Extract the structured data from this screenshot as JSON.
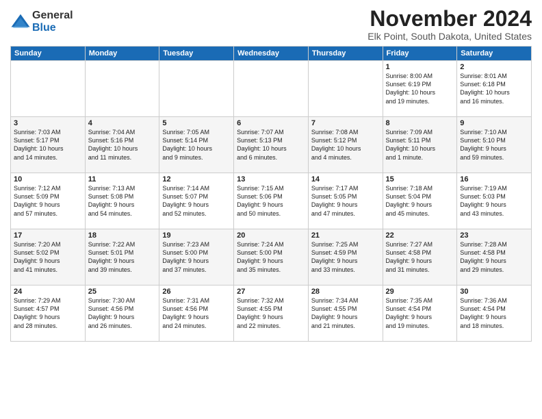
{
  "logo": {
    "general": "General",
    "blue": "Blue"
  },
  "title": "November 2024",
  "location": "Elk Point, South Dakota, United States",
  "days_of_week": [
    "Sunday",
    "Monday",
    "Tuesday",
    "Wednesday",
    "Thursday",
    "Friday",
    "Saturday"
  ],
  "weeks": [
    [
      {
        "day": "",
        "info": ""
      },
      {
        "day": "",
        "info": ""
      },
      {
        "day": "",
        "info": ""
      },
      {
        "day": "",
        "info": ""
      },
      {
        "day": "",
        "info": ""
      },
      {
        "day": "1",
        "info": "Sunrise: 8:00 AM\nSunset: 6:19 PM\nDaylight: 10 hours\nand 19 minutes."
      },
      {
        "day": "2",
        "info": "Sunrise: 8:01 AM\nSunset: 6:18 PM\nDaylight: 10 hours\nand 16 minutes."
      }
    ],
    [
      {
        "day": "3",
        "info": "Sunrise: 7:03 AM\nSunset: 5:17 PM\nDaylight: 10 hours\nand 14 minutes."
      },
      {
        "day": "4",
        "info": "Sunrise: 7:04 AM\nSunset: 5:16 PM\nDaylight: 10 hours\nand 11 minutes."
      },
      {
        "day": "5",
        "info": "Sunrise: 7:05 AM\nSunset: 5:14 PM\nDaylight: 10 hours\nand 9 minutes."
      },
      {
        "day": "6",
        "info": "Sunrise: 7:07 AM\nSunset: 5:13 PM\nDaylight: 10 hours\nand 6 minutes."
      },
      {
        "day": "7",
        "info": "Sunrise: 7:08 AM\nSunset: 5:12 PM\nDaylight: 10 hours\nand 4 minutes."
      },
      {
        "day": "8",
        "info": "Sunrise: 7:09 AM\nSunset: 5:11 PM\nDaylight: 10 hours\nand 1 minute."
      },
      {
        "day": "9",
        "info": "Sunrise: 7:10 AM\nSunset: 5:10 PM\nDaylight: 9 hours\nand 59 minutes."
      }
    ],
    [
      {
        "day": "10",
        "info": "Sunrise: 7:12 AM\nSunset: 5:09 PM\nDaylight: 9 hours\nand 57 minutes."
      },
      {
        "day": "11",
        "info": "Sunrise: 7:13 AM\nSunset: 5:08 PM\nDaylight: 9 hours\nand 54 minutes."
      },
      {
        "day": "12",
        "info": "Sunrise: 7:14 AM\nSunset: 5:07 PM\nDaylight: 9 hours\nand 52 minutes."
      },
      {
        "day": "13",
        "info": "Sunrise: 7:15 AM\nSunset: 5:06 PM\nDaylight: 9 hours\nand 50 minutes."
      },
      {
        "day": "14",
        "info": "Sunrise: 7:17 AM\nSunset: 5:05 PM\nDaylight: 9 hours\nand 47 minutes."
      },
      {
        "day": "15",
        "info": "Sunrise: 7:18 AM\nSunset: 5:04 PM\nDaylight: 9 hours\nand 45 minutes."
      },
      {
        "day": "16",
        "info": "Sunrise: 7:19 AM\nSunset: 5:03 PM\nDaylight: 9 hours\nand 43 minutes."
      }
    ],
    [
      {
        "day": "17",
        "info": "Sunrise: 7:20 AM\nSunset: 5:02 PM\nDaylight: 9 hours\nand 41 minutes."
      },
      {
        "day": "18",
        "info": "Sunrise: 7:22 AM\nSunset: 5:01 PM\nDaylight: 9 hours\nand 39 minutes."
      },
      {
        "day": "19",
        "info": "Sunrise: 7:23 AM\nSunset: 5:00 PM\nDaylight: 9 hours\nand 37 minutes."
      },
      {
        "day": "20",
        "info": "Sunrise: 7:24 AM\nSunset: 5:00 PM\nDaylight: 9 hours\nand 35 minutes."
      },
      {
        "day": "21",
        "info": "Sunrise: 7:25 AM\nSunset: 4:59 PM\nDaylight: 9 hours\nand 33 minutes."
      },
      {
        "day": "22",
        "info": "Sunrise: 7:27 AM\nSunset: 4:58 PM\nDaylight: 9 hours\nand 31 minutes."
      },
      {
        "day": "23",
        "info": "Sunrise: 7:28 AM\nSunset: 4:58 PM\nDaylight: 9 hours\nand 29 minutes."
      }
    ],
    [
      {
        "day": "24",
        "info": "Sunrise: 7:29 AM\nSunset: 4:57 PM\nDaylight: 9 hours\nand 28 minutes."
      },
      {
        "day": "25",
        "info": "Sunrise: 7:30 AM\nSunset: 4:56 PM\nDaylight: 9 hours\nand 26 minutes."
      },
      {
        "day": "26",
        "info": "Sunrise: 7:31 AM\nSunset: 4:56 PM\nDaylight: 9 hours\nand 24 minutes."
      },
      {
        "day": "27",
        "info": "Sunrise: 7:32 AM\nSunset: 4:55 PM\nDaylight: 9 hours\nand 22 minutes."
      },
      {
        "day": "28",
        "info": "Sunrise: 7:34 AM\nSunset: 4:55 PM\nDaylight: 9 hours\nand 21 minutes."
      },
      {
        "day": "29",
        "info": "Sunrise: 7:35 AM\nSunset: 4:54 PM\nDaylight: 9 hours\nand 19 minutes."
      },
      {
        "day": "30",
        "info": "Sunrise: 7:36 AM\nSunset: 4:54 PM\nDaylight: 9 hours\nand 18 minutes."
      }
    ]
  ]
}
